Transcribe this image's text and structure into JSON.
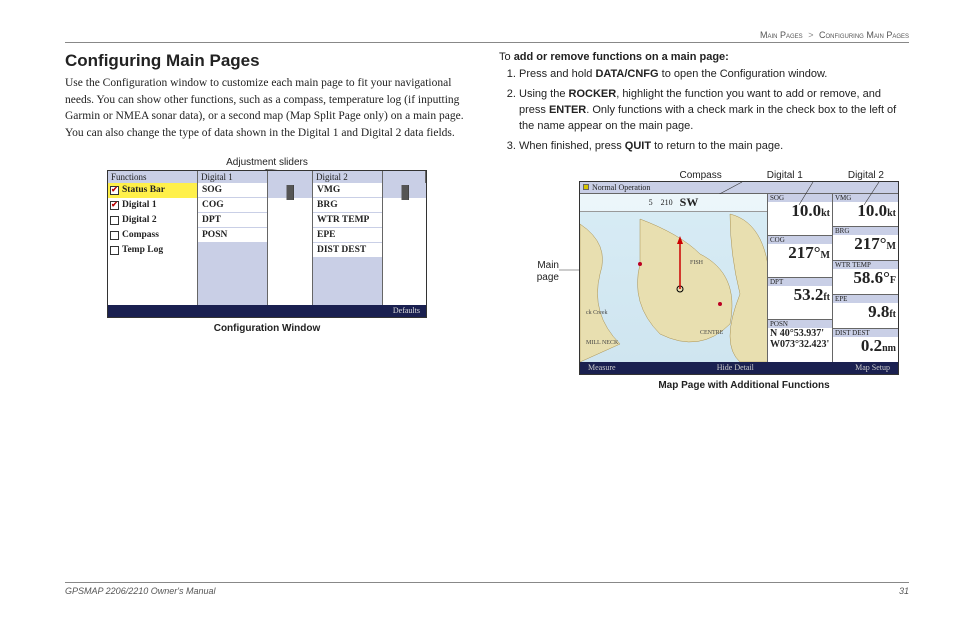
{
  "breadcrumb": {
    "a": "Main Pages",
    "sep": ">",
    "b": "Configuring Main Pages"
  },
  "heading": "Configuring Main Pages",
  "intro": "Use the Configuration window to customize each main page to fit your navigational needs. You can show other functions, such as a compass, temperature log (if inputting Garmin or NMEA sonar data), or a second map (Map Split Page only) on a main page. You can also change the type of data shown in the Digital 1 and Digital 2 data fields.",
  "adjust_label": "Adjustment sliders",
  "config_headers": {
    "functions": "Functions",
    "d1": "Digital 1",
    "d2": "Digital 2"
  },
  "functions": [
    {
      "label": "Status Bar",
      "checked": true,
      "selected": true
    },
    {
      "label": "Digital 1",
      "checked": true
    },
    {
      "label": "Digital 2",
      "checked": false
    },
    {
      "label": "Compass",
      "checked": false
    },
    {
      "label": "Temp Log",
      "checked": false
    }
  ],
  "d1_items": [
    "SOG",
    "COG",
    "DPT",
    "POSN"
  ],
  "d2_items": [
    "VMG",
    "BRG",
    "WTR TEMP",
    "EPE",
    "DIST DEST"
  ],
  "config_footer": "Defaults",
  "config_caption": "Configuration Window",
  "proc_title_to": "To",
  "proc_title": "add or remove functions on a main page:",
  "steps": [
    "Press and hold <b>DATA/CNFG</b> to open the Configuration window.",
    "Using the <b>ROCKER</b>, highlight the function you want to add or remove, and press <b>ENTER</b>. Only functions with a check mark in the check box to the left of the name appear on the main page.",
    "When finished, press <b>QUIT</b> to return to the main page."
  ],
  "map_top_labels": {
    "compass": "Compass",
    "d1": "Digital 1",
    "d2": "Digital 2"
  },
  "side_label": "Main page",
  "map_titlebar": "Normal Operation",
  "compass_ticks": "5    210    SW",
  "data_left": [
    {
      "lbl": "SOG",
      "val": "10.0",
      "unit": "kt"
    },
    {
      "lbl": "COG",
      "val": "217°",
      "unit": "M"
    },
    {
      "lbl": "DPT",
      "val": "53.2",
      "unit": "ft"
    },
    {
      "lbl": "POSN",
      "posn1": "N  40°53.937'",
      "posn2": "W073°32.423'"
    }
  ],
  "data_right": [
    {
      "lbl": "VMG",
      "val": "10.0",
      "unit": "kt"
    },
    {
      "lbl": "BRG",
      "val": "217°",
      "unit": "M"
    },
    {
      "lbl": "WTR TEMP",
      "val": "58.6°",
      "unit": "F"
    },
    {
      "lbl": "EPE",
      "val": "9.8",
      "unit": "ft"
    },
    {
      "lbl": "DIST DEST",
      "val": "0.2",
      "unit": "nm"
    }
  ],
  "map_footer": {
    "a": "Measure",
    "b": "Hide Detail",
    "c": "Map Setup"
  },
  "map_caption": "Map Page with Additional Functions",
  "footer": {
    "manual": "GPSMAP 2206/2210 Owner's Manual",
    "page": "31"
  }
}
